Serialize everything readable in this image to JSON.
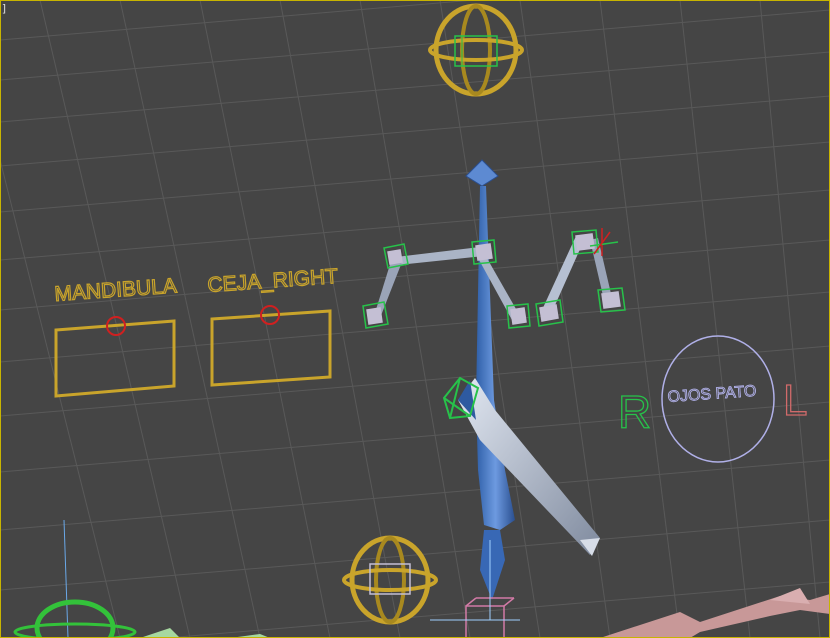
{
  "viewport": {
    "corner_bracket": "]"
  },
  "labels": {
    "mandibula": "MANDIBULA",
    "ceja_right": "CEJA_RIGHT",
    "ojos_pato": "OJOS PATO",
    "letter_r": "R",
    "letter_l": "L"
  },
  "colors": {
    "background": "#454545",
    "grid": "#585858",
    "viewport_border": "#c8b400",
    "gold": "#c9a42b",
    "bone_blue": "#4a78c0",
    "bone_gray": "#b8c4d8",
    "helper_green": "#27c24a",
    "red_marker": "#d02020",
    "circle_lavender": "#b0b0e8",
    "pink": "#c89898"
  },
  "icons": {
    "axis_tripod": "axis-tripod-icon"
  }
}
